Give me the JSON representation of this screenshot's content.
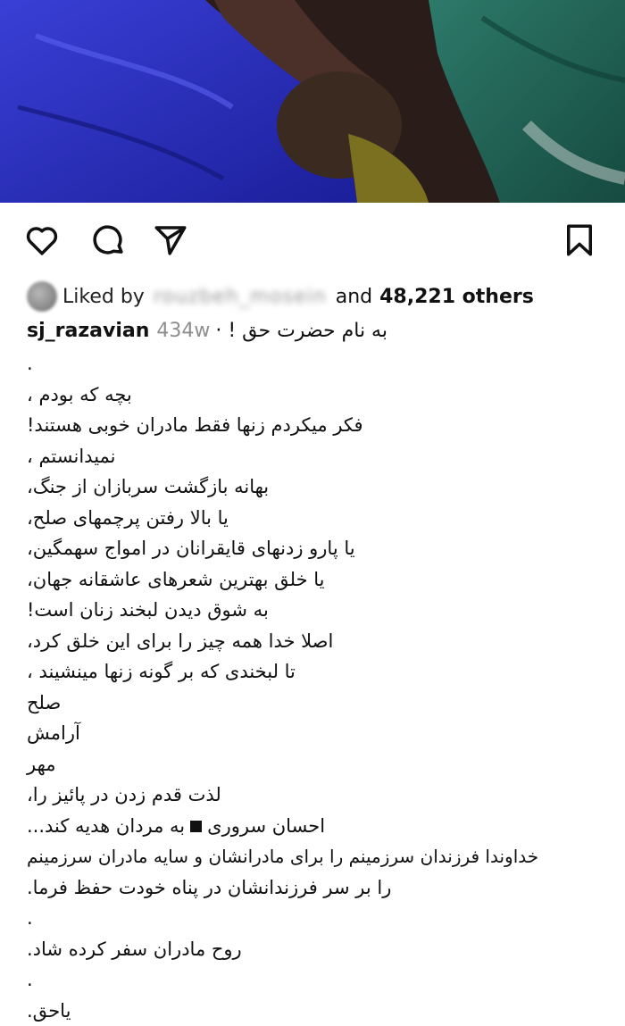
{
  "post": {
    "liked_prefix": "Liked by",
    "liked_by_name": "rouzbeh_mosein",
    "liked_and": "and",
    "liked_count": "48,221 others"
  },
  "caption": {
    "username": "sj_razavian",
    "age": "434w",
    "first_line": "به نام حضرت حق ! ·",
    "lines": [
      ".",
      "بچه که بودم ،",
      "فکر میکردم زنها فقط مادران خوبی هستند!",
      "نمیدانستم ،",
      "بهانه بازگشت سربازان از جنگ،",
      "یا بالا رفتن پرچمهای صلح،",
      "یا پارو زدنهای قایقرانان در امواج سهمگین،",
      "یا خلق بهترین شعرهای عاشقانه جهان،",
      "به شوق دیدن لبخند زنان است!",
      "اصلا خدا همه چیز را برای این خلق کرد،",
      "تا لبخندی که بر گونه زنها مینشیند ،",
      "صلح",
      "آرامش",
      "مهر",
      "لذت قدم زدن در پائیز را،",
      "به مردان هدیه کند...",
      "خداوندا فرزندان سرزمینم را برای مادرانشان و سایه مادران سرزمینم",
      "را بر سر فرزندانشان در پناه خودت حفظ فرما.",
      ".",
      "روح مادران سفر کرده شاد.",
      ".",
      "یاحق."
    ],
    "author": "احسان سروری"
  },
  "icons": {
    "like": "heart-icon",
    "comment": "comment-icon",
    "share": "paper-plane-icon",
    "save": "bookmark-icon"
  },
  "colors": {
    "text": "#111111",
    "muted": "#8e8e8e"
  }
}
